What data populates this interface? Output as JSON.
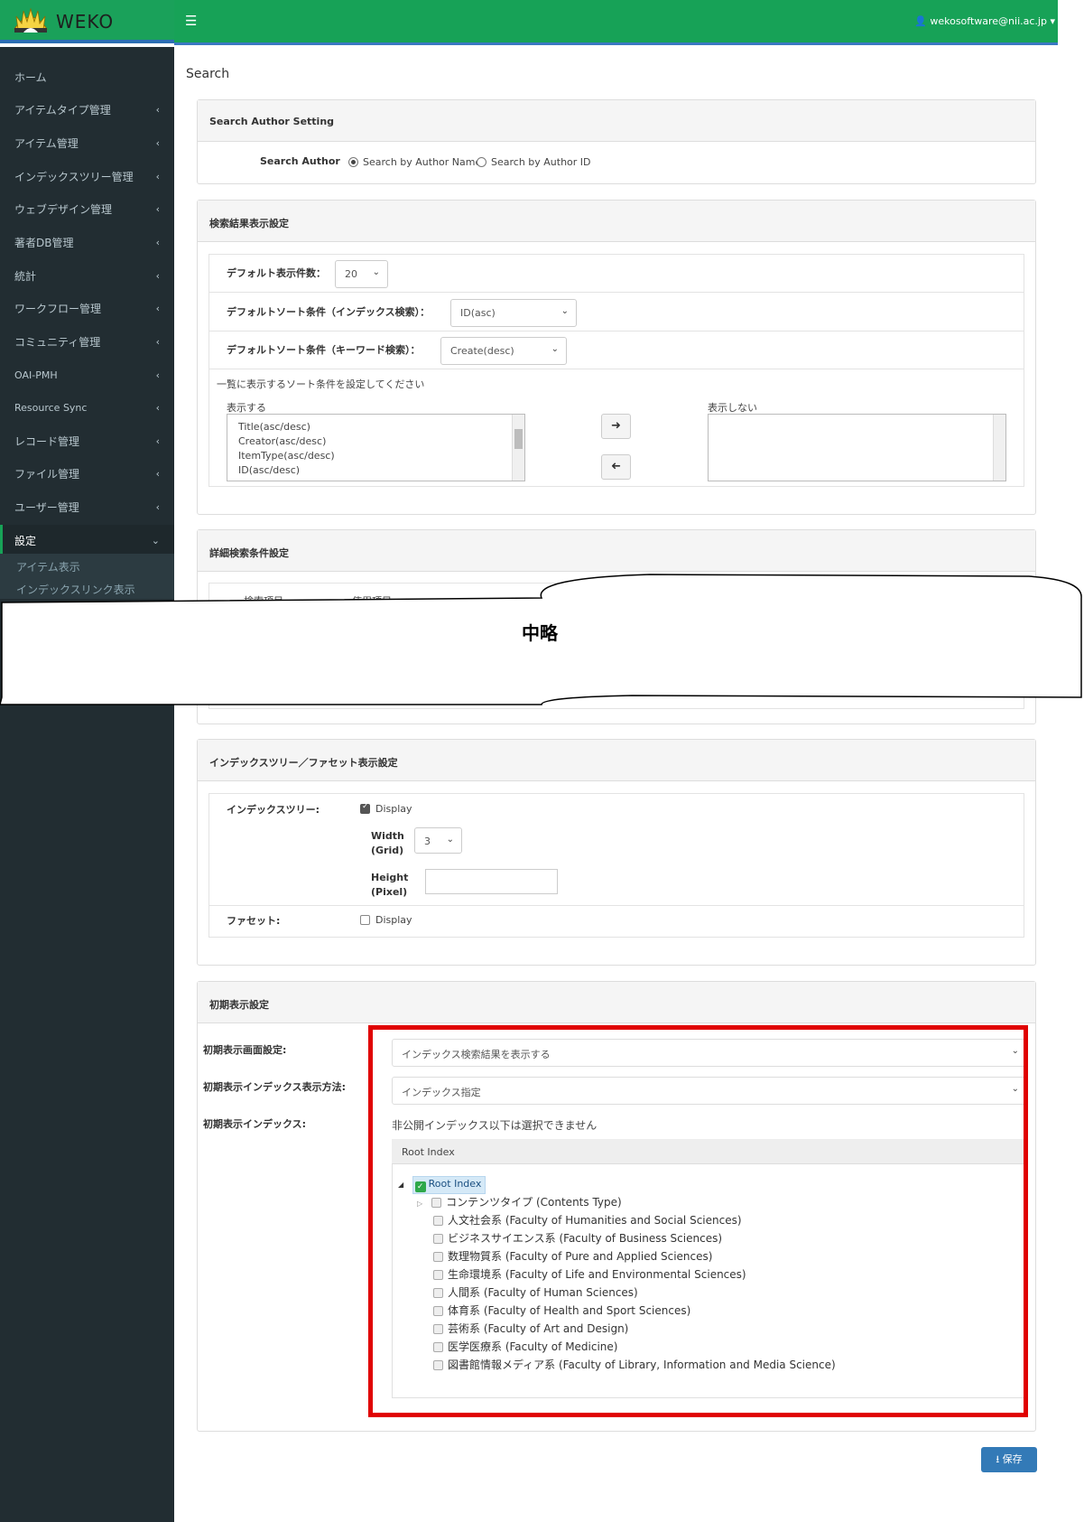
{
  "app": {
    "logo_text": "WEKO",
    "user_label": "wekosoftware@nii.ac.jp"
  },
  "sidebar": {
    "items": [
      {
        "label": "ホーム"
      },
      {
        "label": "アイテムタイプ管理"
      },
      {
        "label": "アイテム管理"
      },
      {
        "label": "インデックスツリー管理"
      },
      {
        "label": "ウェブデザイン管理"
      },
      {
        "label": "著者DB管理"
      },
      {
        "label": "統計"
      },
      {
        "label": "ワークフロー管理"
      },
      {
        "label": "コミュニティ管理"
      },
      {
        "label": "OAI-PMH"
      },
      {
        "label": "Resource Sync"
      },
      {
        "label": "レコード管理"
      },
      {
        "label": "ファイル管理"
      },
      {
        "label": "ユーザー管理"
      },
      {
        "label": "設定"
      }
    ],
    "sub_items": [
      {
        "label": "アイテム表示"
      },
      {
        "label": "インデックスリンク表示"
      }
    ]
  },
  "page": {
    "title": "Search"
  },
  "author_panel": {
    "header": "Search Author Setting",
    "label": "Search Author",
    "option1": "Search by Author Name",
    "option2": "Search by Author ID"
  },
  "result_panel": {
    "header": "検索結果表示設定",
    "default_count_label": "デフォルト表示件数：",
    "default_count_value": "20",
    "sort_index_label": "デフォルトソート条件（インデックス検索）：",
    "sort_index_value": "ID(asc)",
    "sort_keyword_label": "デフォルトソート条件（キーワード検索）：",
    "sort_keyword_value": "Create(desc)",
    "instruction": "一覧に表示するソート条件を設定してください",
    "show_label": "表示する",
    "hide_label": "表示しない",
    "show_items": [
      "Title(asc/desc)",
      "Creator(asc/desc)",
      "ItemType(asc/desc)",
      "ID(asc/desc)"
    ]
  },
  "detail_panel": {
    "header": "詳細検索条件設定",
    "col1": "検索項目",
    "col2": "使用項目"
  },
  "omission": {
    "label": "中略"
  },
  "tree_panel": {
    "header": "インデックスツリー／ファセット表示設定",
    "tree_label": "インデックスツリー:",
    "display": "Display",
    "width_label_1": "Width",
    "width_label_2": "(Grid)",
    "width_value": "3",
    "height_label_1": "Height",
    "height_label_2": "(Pixel)",
    "facet_label": "ファセット:",
    "facet_display": "Display"
  },
  "init_panel": {
    "header": "初期表示設定",
    "screen_label": "初期表示画面設定:",
    "screen_value": "インデックス検索結果を表示する",
    "method_label": "初期表示インデックス表示方法:",
    "method_value": "インデックス指定",
    "index_label": "初期表示インデックス:",
    "note": "非公開インデックス以下は選択できません",
    "tree_header": "Root Index",
    "root_node": "Root Index",
    "nodes": [
      "コンテンツタイプ (Contents Type)",
      "人文社会系 (Faculty of Humanities and Social Sciences)",
      "ビジネスサイエンス系 (Faculty of Business Sciences)",
      "数理物質系 (Faculty of Pure and Applied Sciences)",
      "生命環境系 (Faculty of Life and Environmental Sciences)",
      "人間系 (Faculty of Human Sciences)",
      "体育系 (Faculty of Health and Sport Sciences)",
      "芸術系 (Faculty of Art and Design)",
      "医学医療系 (Faculty of Medicine)",
      "図書館情報メディア系 (Faculty of Library, Information and Media Science)"
    ]
  },
  "save_button": {
    "label": "保存"
  },
  "colors": {
    "header_green": "#17a257",
    "sidebar_dark": "#222d32",
    "highlight_red": "#e00000",
    "primary_blue": "#337ab7"
  }
}
